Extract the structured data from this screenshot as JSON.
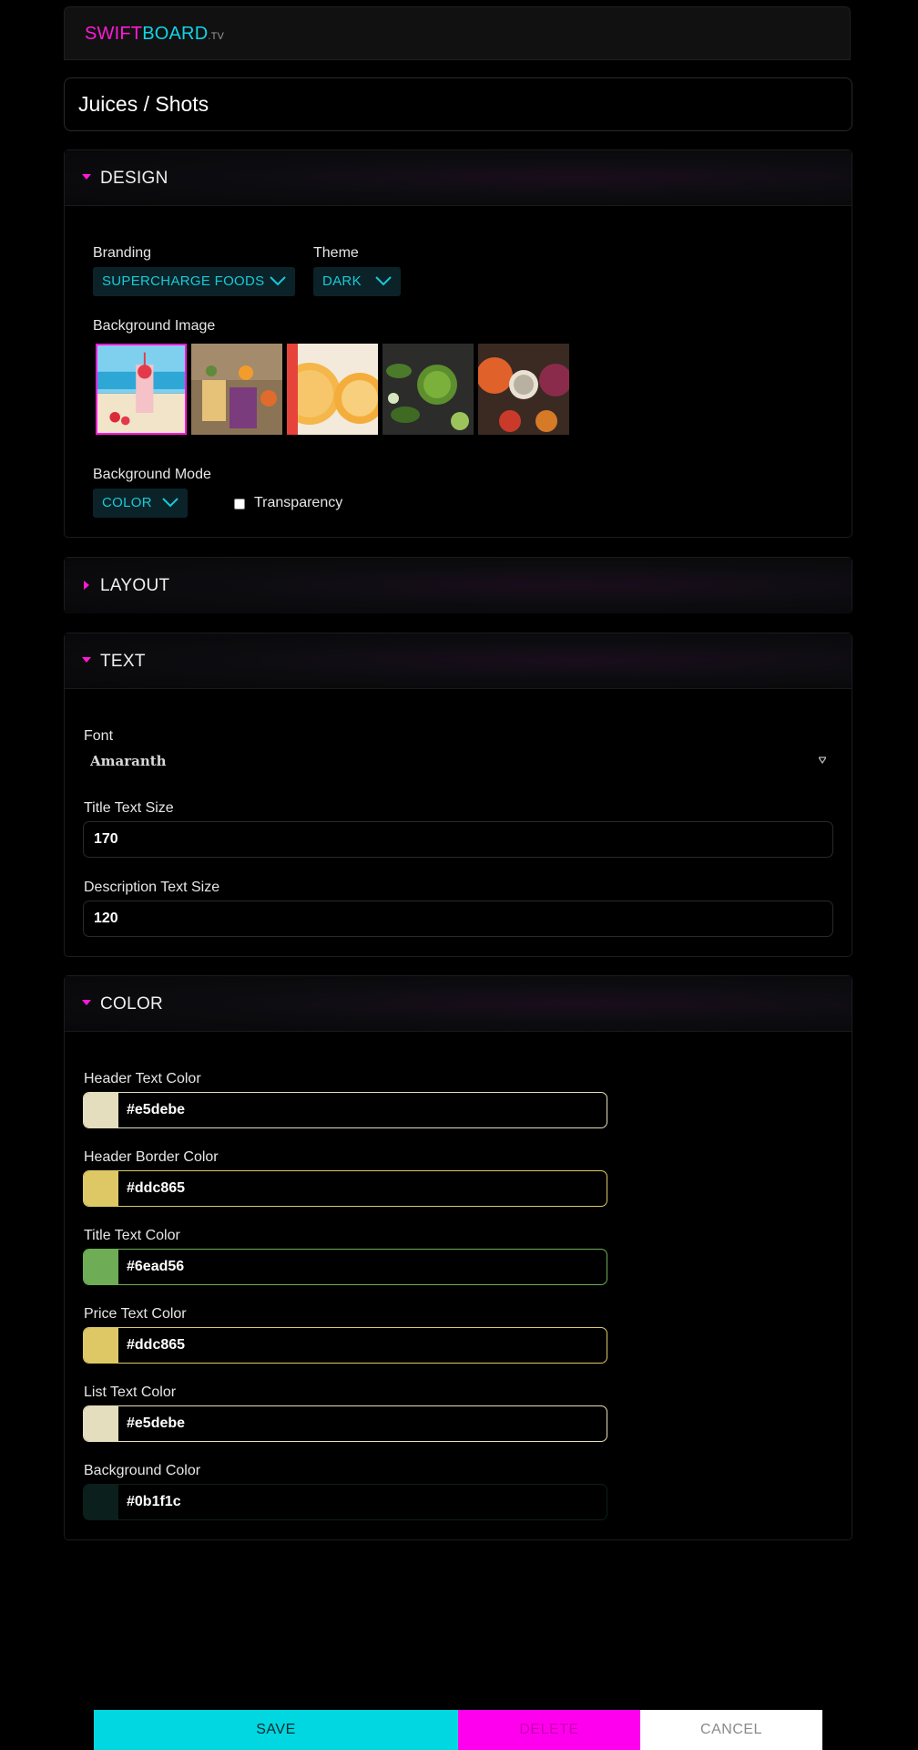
{
  "logo": {
    "part1": "SWIFT",
    "part2": "BOARD",
    "part3": ".TV"
  },
  "page_title": "Juices / Shots",
  "design": {
    "title": "DESIGN",
    "branding_label": "Branding",
    "branding_value": "SUPERCHARGE FOODS",
    "theme_label": "Theme",
    "theme_value": "DARK",
    "bg_image_label": "Background Image",
    "bg_mode_label": "Background Mode",
    "bg_mode_value": "COLOR",
    "transparency_label": "Transparency"
  },
  "layout": {
    "title": "LAYOUT"
  },
  "text": {
    "title": "TEXT",
    "font_label": "Font",
    "font_value": "Amaranth",
    "title_size_label": "Title Text Size",
    "title_size_value": "170",
    "desc_size_label": "Description Text Size",
    "desc_size_value": "120"
  },
  "color": {
    "title": "COLOR",
    "rows": [
      {
        "label": "Header Text Color",
        "value": "#e5debe"
      },
      {
        "label": "Header Border Color",
        "value": "#ddc865"
      },
      {
        "label": "Title Text Color",
        "value": "#6ead56"
      },
      {
        "label": "Price Text Color",
        "value": "#ddc865"
      },
      {
        "label": "List Text Color",
        "value": "#e5debe"
      },
      {
        "label": "Background Color",
        "value": "#0b1f1c"
      }
    ]
  },
  "buttons": {
    "save": "SAVE",
    "delete": "DELETE",
    "cancel": "CANCEL"
  },
  "colors": {
    "accent_magenta": "#ff19d6",
    "accent_cyan": "#00d7e1"
  }
}
